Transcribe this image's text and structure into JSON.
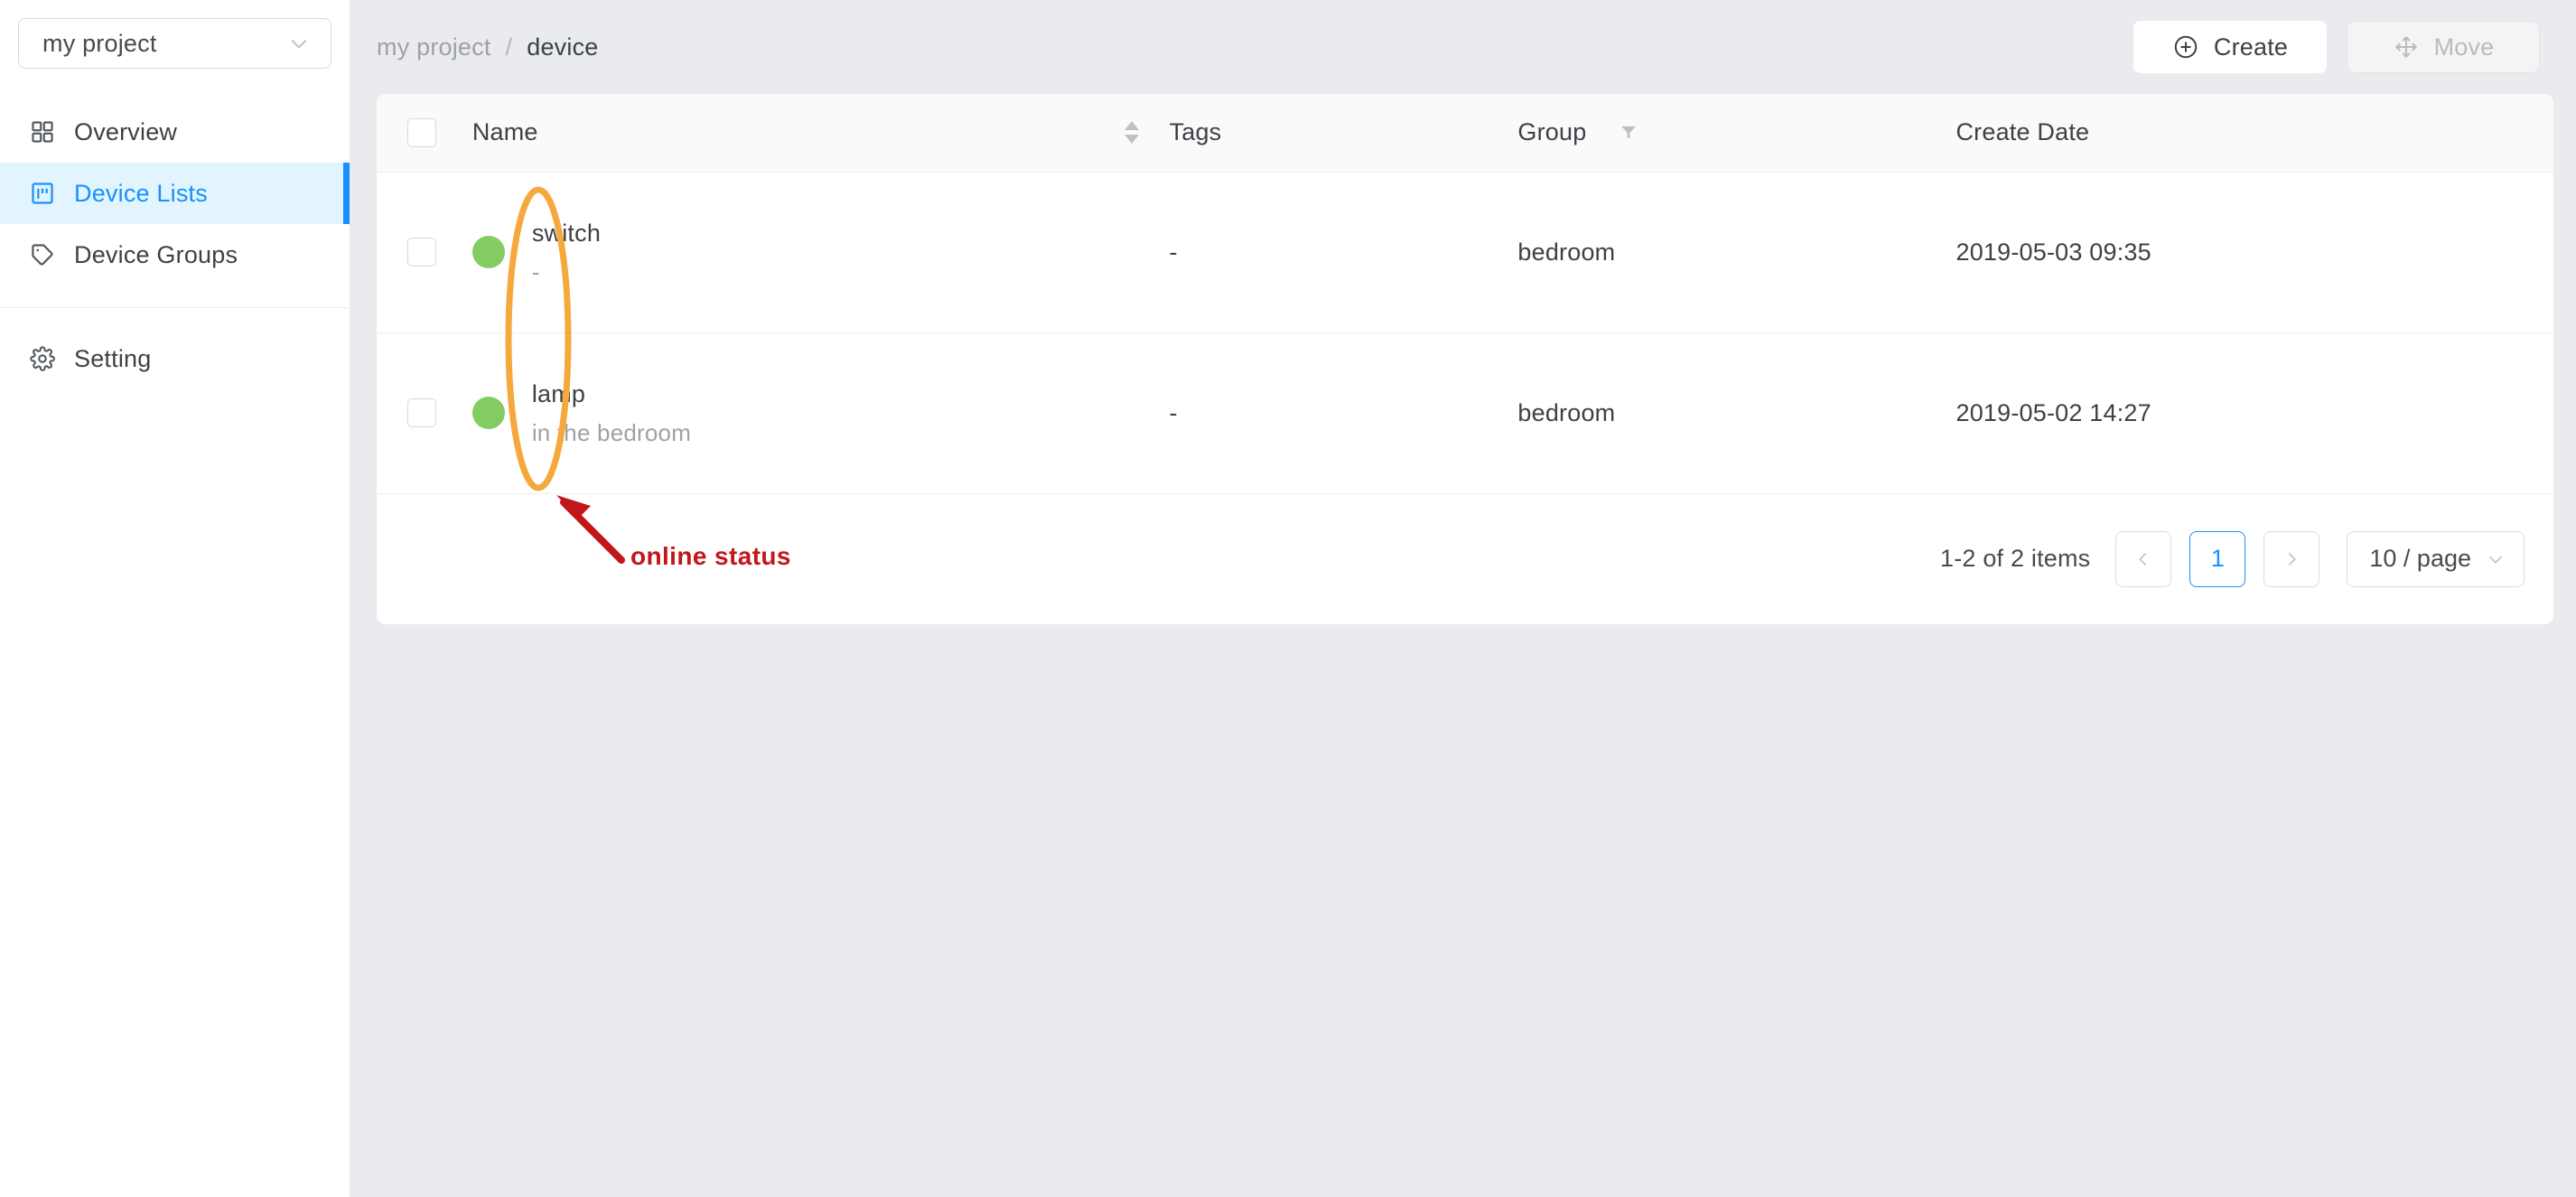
{
  "sidebar": {
    "project_selector": {
      "value": "my project",
      "icon": "chevron-down-icon"
    },
    "items": [
      {
        "label": "Overview",
        "icon": "grid-icon",
        "active": false
      },
      {
        "label": "Device Lists",
        "icon": "board-icon",
        "active": true
      },
      {
        "label": "Device Groups",
        "icon": "tag-icon",
        "active": false
      },
      {
        "label": "Setting",
        "icon": "gear-icon",
        "active": false
      }
    ]
  },
  "header": {
    "breadcrumb": {
      "root": "my project",
      "separator": "/",
      "current": "device"
    },
    "buttons": {
      "create": {
        "label": "Create",
        "icon": "plus-circle-icon",
        "disabled": false
      },
      "move": {
        "label": "Move",
        "icon": "move-arrows-icon",
        "disabled": true
      }
    }
  },
  "table": {
    "columns": [
      {
        "key": "check",
        "label": ""
      },
      {
        "key": "name",
        "label": "Name",
        "sortable": true
      },
      {
        "key": "tags",
        "label": "Tags"
      },
      {
        "key": "group",
        "label": "Group",
        "filterable": true
      },
      {
        "key": "date",
        "label": "Create Date"
      }
    ],
    "rows": [
      {
        "checked": false,
        "status": "online",
        "status_color": "#82cc61",
        "name": "switch",
        "description": "-",
        "tags": "-",
        "group": "bedroom",
        "create_date": "2019-05-03 09:35"
      },
      {
        "checked": false,
        "status": "online",
        "status_color": "#82cc61",
        "name": "lamp",
        "description": "in the bedroom",
        "tags": "-",
        "group": "bedroom",
        "create_date": "2019-05-02 14:27"
      }
    ]
  },
  "pagination": {
    "summary": "1-2 of 2 items",
    "prev_label": "‹",
    "next_label": "›",
    "current_page": "1",
    "page_size": "10 / page",
    "page_size_icon": "chevron-down-icon"
  },
  "annotations": {
    "online_status": {
      "text": "online status",
      "color": "#c1171b",
      "highlight_color": "#f5a93c"
    }
  }
}
